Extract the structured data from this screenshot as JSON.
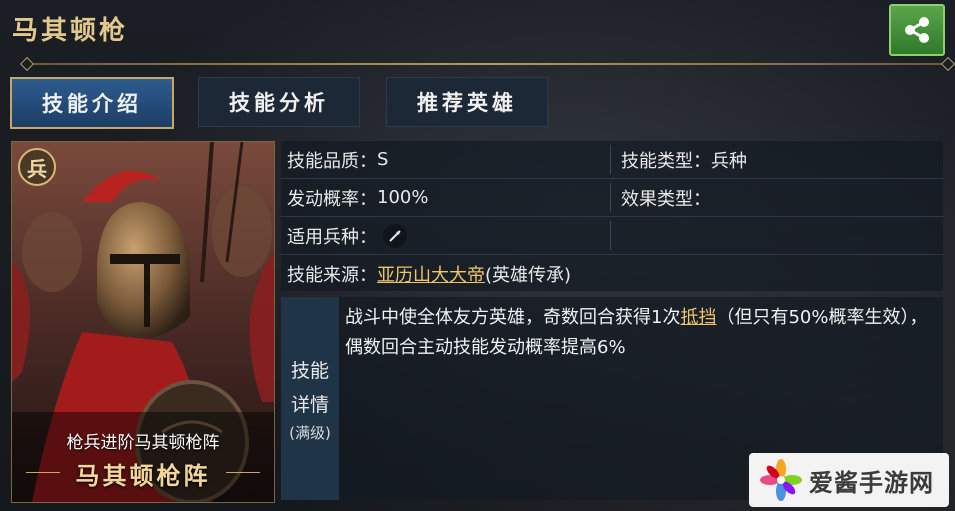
{
  "header": {
    "title": "马其顿枪"
  },
  "tabs": [
    {
      "label": "技能介绍",
      "active": true
    },
    {
      "label": "技能分析",
      "active": false
    },
    {
      "label": "推荐英雄",
      "active": false
    }
  ],
  "card": {
    "badge": "兵",
    "subtitle": "枪兵进阶马其顿枪阵",
    "name": "马其顿枪阵"
  },
  "info": {
    "quality_label": "技能品质：",
    "quality_value": "S",
    "type_label": "技能类型：",
    "type_value": "兵种",
    "rate_label": "发动概率：",
    "rate_value": "100%",
    "effect_label": "效果类型：",
    "effect_value": "",
    "troop_label": "适用兵种：",
    "troop_icon": "spear-icon",
    "source_label": "技能来源：",
    "source_link": "亚历山大大帝",
    "source_suffix": "(英雄传承)"
  },
  "detail": {
    "label_line1": "技能",
    "label_line2": "详情",
    "label_sub": "(满级)",
    "text_before": "战斗中使全体友方英雄，奇数回合获得1次",
    "text_link": "抵挡",
    "text_after": "（但只有50%概率生效），偶数回合主动技能发动概率提高6%"
  },
  "watermark": {
    "text": "爱酱手游网"
  },
  "colors": {
    "accent_gold": "#e3c88e",
    "tab_active": "#2d5c8f",
    "link": "#f0c46a",
    "share_green": "#3f8f35"
  }
}
